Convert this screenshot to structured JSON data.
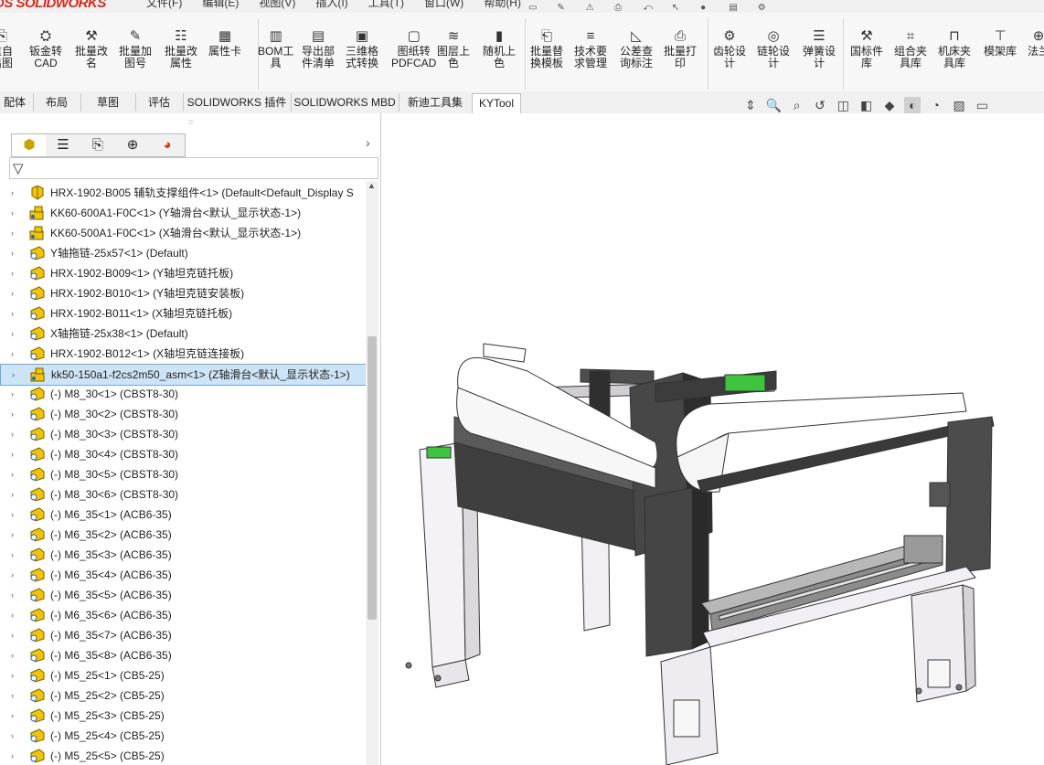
{
  "app": {
    "logo": "DS SOLIDWORKS"
  },
  "menus": [
    "文件(F)",
    "编辑(E)",
    "视图(V)",
    "插入(I)",
    "工具(T)",
    "窗口(W)",
    "帮助(H)"
  ],
  "ribbon": [
    {
      "label": "重自\n出图",
      "icon": "export-drawing-icon"
    },
    {
      "label": "钣金转\nCAD",
      "icon": "sheetmetal-icon"
    },
    {
      "label": "批量改\n名",
      "icon": "batch-rename-icon"
    },
    {
      "label": "批量加\n图号",
      "icon": "batch-number-icon"
    },
    {
      "label": "批量改\n属性",
      "icon": "batch-property-icon"
    },
    {
      "label": "属性卡",
      "icon": "property-card-icon"
    },
    {
      "label": "BOM工\n具",
      "icon": "bom-icon"
    },
    {
      "label": "导出部\n件清单",
      "icon": "export-list-icon"
    },
    {
      "label": "三维格\n式转换",
      "icon": "3d-convert-icon"
    },
    {
      "label": "图纸转\nPDFCAD",
      "icon": "pdf-icon"
    },
    {
      "label": "图层上\n色",
      "icon": "layer-color-icon"
    },
    {
      "label": "随机上\n色",
      "icon": "random-color-icon"
    },
    {
      "label": "批量替\n换模板",
      "icon": "replace-template-icon"
    },
    {
      "label": "技术要\n求管理",
      "icon": "tech-req-icon"
    },
    {
      "label": "公差查\n询标注",
      "icon": "tolerance-icon"
    },
    {
      "label": "批量打\n印",
      "icon": "print-icon"
    },
    {
      "label": "齿轮设\n计",
      "icon": "gear-icon"
    },
    {
      "label": "链轮设\n计",
      "icon": "sprocket-icon"
    },
    {
      "label": "弹簧设\n计",
      "icon": "spring-icon"
    },
    {
      "label": "国标件\n库",
      "icon": "standard-parts-icon"
    },
    {
      "label": "组合夹\n具库",
      "icon": "fixture-icon"
    },
    {
      "label": "机床夹\n具库",
      "icon": "machine-fixture-icon"
    },
    {
      "label": "模架库",
      "icon": "mold-base-icon"
    },
    {
      "label": "法兰",
      "icon": "flange-icon"
    }
  ],
  "tabs": [
    "配体",
    "布局",
    "草图",
    "评估",
    "SOLIDWORKS 插件",
    "SOLIDWORKS MBD",
    "新迪工具集",
    "KYTool"
  ],
  "active_tab": "KYTool",
  "tree": [
    {
      "text": "HRX-1902-B005 辅轨支撑组件<1> (Default<Default_Display S",
      "icon": "assembly"
    },
    {
      "text": "KK60-600A1-F0C<1> (Y轴滑台<默认_显示状态-1>)",
      "icon": "sub-assembly"
    },
    {
      "text": "KK60-500A1-F0C<1> (X轴滑台<默认_显示状态-1>)",
      "icon": "sub-assembly"
    },
    {
      "text": "Y轴拖链-25x57<1> (Default)",
      "icon": "part"
    },
    {
      "text": "HRX-1902-B009<1> (Y轴坦克链托板)",
      "icon": "part"
    },
    {
      "text": "HRX-1902-B010<1> (Y轴坦克链安装板)",
      "icon": "part"
    },
    {
      "text": "HRX-1902-B011<1> (X轴坦克链托板)",
      "icon": "part"
    },
    {
      "text": "X轴拖链-25x38<1> (Default)",
      "icon": "part"
    },
    {
      "text": "HRX-1902-B012<1> (X轴坦克链连接板)",
      "icon": "part"
    },
    {
      "text": "kk50-150a1-f2cs2m50_asm<1> (Z轴滑台<默认_显示状态-1>)",
      "icon": "sub-assembly",
      "selected": true
    },
    {
      "text": "(-) M8_30<1> (CBST8-30)",
      "icon": "part"
    },
    {
      "text": "(-) M8_30<2> (CBST8-30)",
      "icon": "part"
    },
    {
      "text": "(-) M8_30<3> (CBST8-30)",
      "icon": "part"
    },
    {
      "text": "(-) M8_30<4> (CBST8-30)",
      "icon": "part"
    },
    {
      "text": "(-) M8_30<5> (CBST8-30)",
      "icon": "part"
    },
    {
      "text": "(-) M8_30<6> (CBST8-30)",
      "icon": "part"
    },
    {
      "text": "(-) M6_35<1> (ACB6-35)",
      "icon": "part"
    },
    {
      "text": "(-) M6_35<2> (ACB6-35)",
      "icon": "part"
    },
    {
      "text": "(-) M6_35<3> (ACB6-35)",
      "icon": "part"
    },
    {
      "text": "(-) M6_35<4> (ACB6-35)",
      "icon": "part"
    },
    {
      "text": "(-) M6_35<5> (ACB6-35)",
      "icon": "part"
    },
    {
      "text": "(-) M6_35<6> (ACB6-35)",
      "icon": "part"
    },
    {
      "text": "(-) M6_35<7> (ACB6-35)",
      "icon": "part"
    },
    {
      "text": "(-) M6_35<8> (ACB6-35)",
      "icon": "part"
    },
    {
      "text": "(-) M5_25<1> (CB5-25)",
      "icon": "part"
    },
    {
      "text": "(-) M5_25<2> (CB5-25)",
      "icon": "part"
    },
    {
      "text": "(-) M5_25<3> (CB5-25)",
      "icon": "part"
    },
    {
      "text": "(-) M5_25<4> (CB5-25)",
      "icon": "part"
    },
    {
      "text": "(-) M5_25<5> (CB5-25)",
      "icon": "part"
    }
  ],
  "colors": {
    "selection": "#cde4f7",
    "brand": "#d52b1e",
    "panel_dark": "#4a4a4a",
    "accent_green": "#3ec43e"
  }
}
